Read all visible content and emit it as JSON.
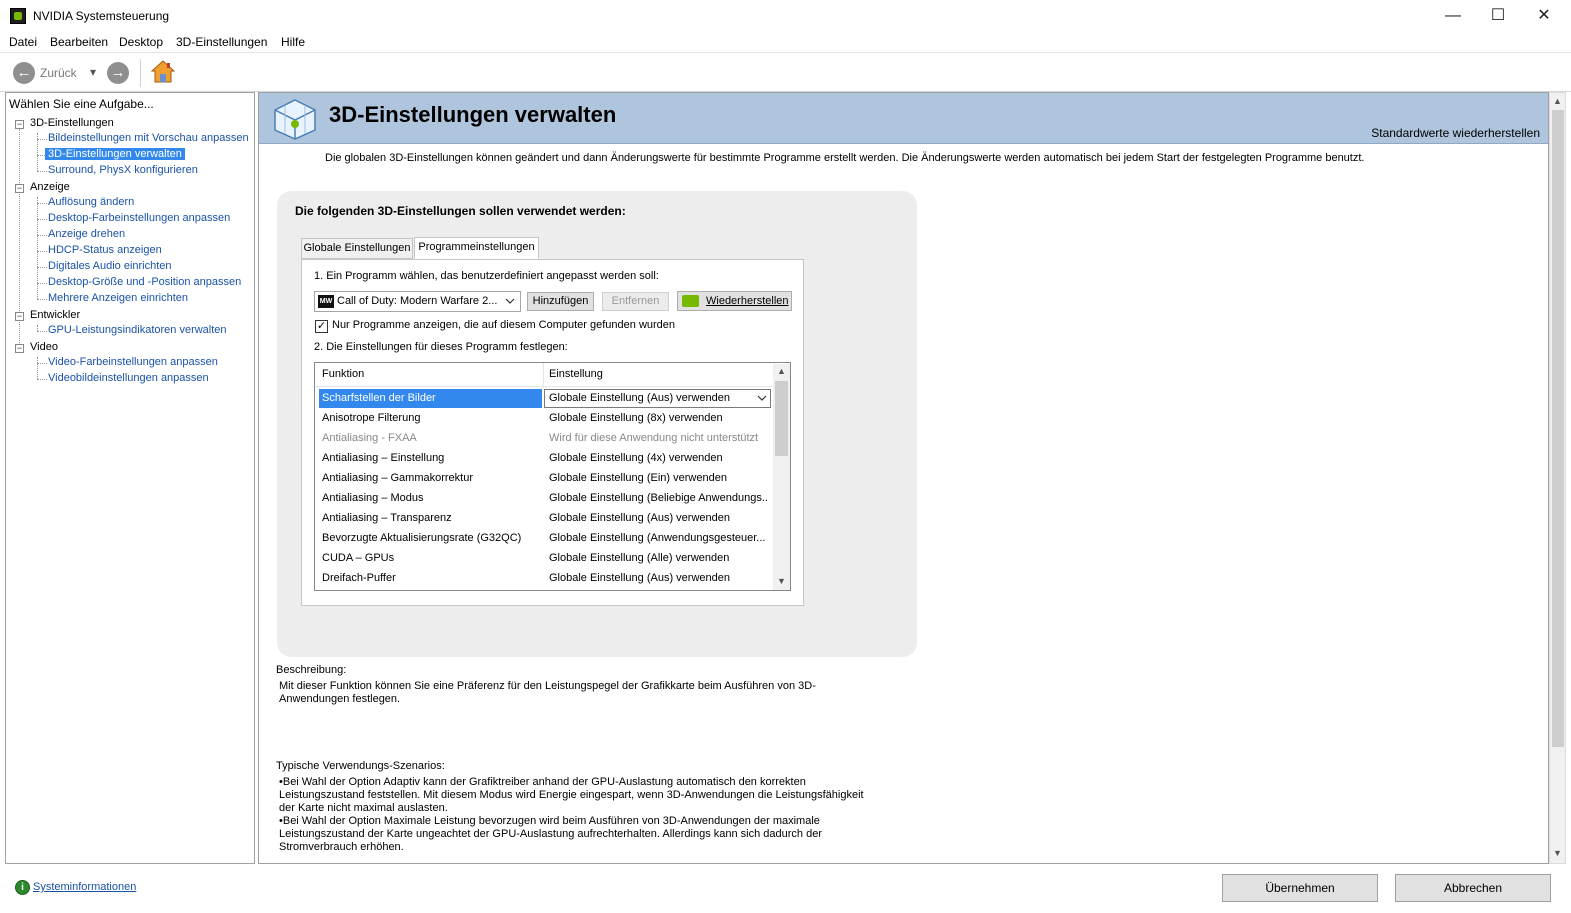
{
  "window": {
    "title": "NVIDIA Systemsteuerung",
    "minimize_glyph": "—",
    "maximize_glyph": "☐",
    "close_glyph": "✕"
  },
  "menu": [
    "Datei",
    "Bearbeiten",
    "Desktop",
    "3D-Einstellungen",
    "Hilfe"
  ],
  "toolbar": {
    "back_label": "Zurück",
    "back_glyph": "←",
    "forward_glyph": "→",
    "dropdown_glyph": "▾"
  },
  "sidebar": {
    "task_title": "Wählen Sie eine Aufgabe...",
    "groups": [
      {
        "label": "3D-Einstellungen",
        "items": [
          "Bildeinstellungen mit Vorschau anpassen",
          "3D-Einstellungen verwalten",
          "Surround, PhysX konfigurieren"
        ]
      },
      {
        "label": "Anzeige",
        "items": [
          "Auflösung ändern",
          "Desktop-Farbeinstellungen anpassen",
          "Anzeige drehen",
          "HDCP-Status anzeigen",
          "Digitales Audio einrichten",
          "Desktop-Größe und -Position anpassen",
          "Mehrere Anzeigen einrichten"
        ]
      },
      {
        "label": "Entwickler",
        "items": [
          "GPU-Leistungsindikatoren verwalten"
        ]
      },
      {
        "label": "Video",
        "items": [
          "Video-Farbeinstellungen anpassen",
          "Videobildeinstellungen anpassen"
        ]
      }
    ],
    "selected_item": "3D-Einstellungen verwalten",
    "collapse_glyph": "−"
  },
  "footer": {
    "sysinfo_label": "Systeminformationen",
    "apply_label": "Übernehmen",
    "cancel_label": "Abbrechen"
  },
  "main": {
    "title": "3D-Einstellungen verwalten",
    "restore_defaults": "Standardwerte wiederherstellen",
    "intro": "Die globalen 3D-Einstellungen können geändert und dann Änderungswerte für bestimmte Programme erstellt werden. Die Änderungswerte werden automatisch bei jedem Start der festgelegten Programme benutzt.",
    "settings_heading": "Die folgenden 3D-Einstellungen sollen verwendet werden:",
    "tabs": [
      "Globale Einstellungen",
      "Programmeinstellungen"
    ],
    "active_tab": "Programmeinstellungen",
    "step1": "1. Ein Programm wählen, das benutzerdefiniert angepasst werden soll:",
    "program_selected": "Call of Duty: Modern Warfare 2...",
    "program_icon_text": "MW",
    "add_button": "Hinzufügen",
    "remove_button": "Entfernen",
    "restore_button": "Wiederherstellen",
    "checkbox_label": "Nur Programme anzeigen, die auf diesem Computer gefunden wurden",
    "checkbox_checked": true,
    "checkbox_glyph": "✓",
    "step2": "2. Die Einstellungen für dieses Programm festlegen:",
    "grid": {
      "headers": [
        "Funktion",
        "Einstellung"
      ],
      "rows": [
        {
          "function": "Scharfstellen der Bilder",
          "setting": "Globale Einstellung (Aus) verwenden",
          "selected": true
        },
        {
          "function": "Anisotrope Filterung",
          "setting": "Globale Einstellung (8x) verwenden"
        },
        {
          "function": "Antialiasing - FXAA",
          "setting": "Wird für diese Anwendung nicht unterstützt",
          "disabled": true
        },
        {
          "function": "Antialiasing – Einstellung",
          "setting": "Globale Einstellung (4x) verwenden"
        },
        {
          "function": "Antialiasing – Gammakorrektur",
          "setting": "Globale Einstellung (Ein) verwenden"
        },
        {
          "function": "Antialiasing – Modus",
          "setting": "Globale Einstellung (Beliebige Anwendungs..."
        },
        {
          "function": "Antialiasing – Transparenz",
          "setting": "Globale Einstellung (Aus) verwenden"
        },
        {
          "function": "Bevorzugte Aktualisierungsrate (G32QC)",
          "setting": "Globale Einstellung (Anwendungsgesteuer..."
        },
        {
          "function": "CUDA – GPUs",
          "setting": "Globale Einstellung (Alle) verwenden"
        },
        {
          "function": "Dreifach-Puffer",
          "setting": "Globale Einstellung (Aus) verwenden"
        }
      ]
    },
    "description_title": "Beschreibung:",
    "description": "Mit dieser Funktion können Sie eine Präferenz für den Leistungspegel der Grafikkarte beim Ausführen von 3D-Anwendungen festlegen.",
    "scenarios_title": "Typische Verwendungs-Szenarios:",
    "scenario_lines": [
      "•Bei Wahl der Option Adaptiv kann der Grafiktreiber anhand der GPU-Auslastung automatisch den korrekten",
      "Leistungszustand feststellen. Mit diesem Modus wird Energie eingespart, wenn 3D-Anwendungen die Leistungsfähigkeit",
      "der Karte nicht maximal auslasten.",
      "•Bei Wahl der Option Maximale Leistung bevorzugen wird beim Ausführen von 3D-Anwendungen der maximale",
      "Leistungszustand der Karte ungeachtet der GPU-Auslastung aufrechterhalten. Allerdings kann sich dadurch der",
      "Stromverbrauch erhöhen."
    ]
  },
  "colors": {
    "header_bg": "#aec5dd",
    "selection": "#3388ee",
    "link": "#1a52a8",
    "nvidia_green": "#76b900"
  },
  "icons": [
    "nvidia-app-icon",
    "back-arrow-icon",
    "forward-arrow-icon",
    "home-icon",
    "3d-cube-icon",
    "nvidia-logo-icon",
    "system-info-icon",
    "checkmark-icon",
    "chevron-down-icon"
  ]
}
